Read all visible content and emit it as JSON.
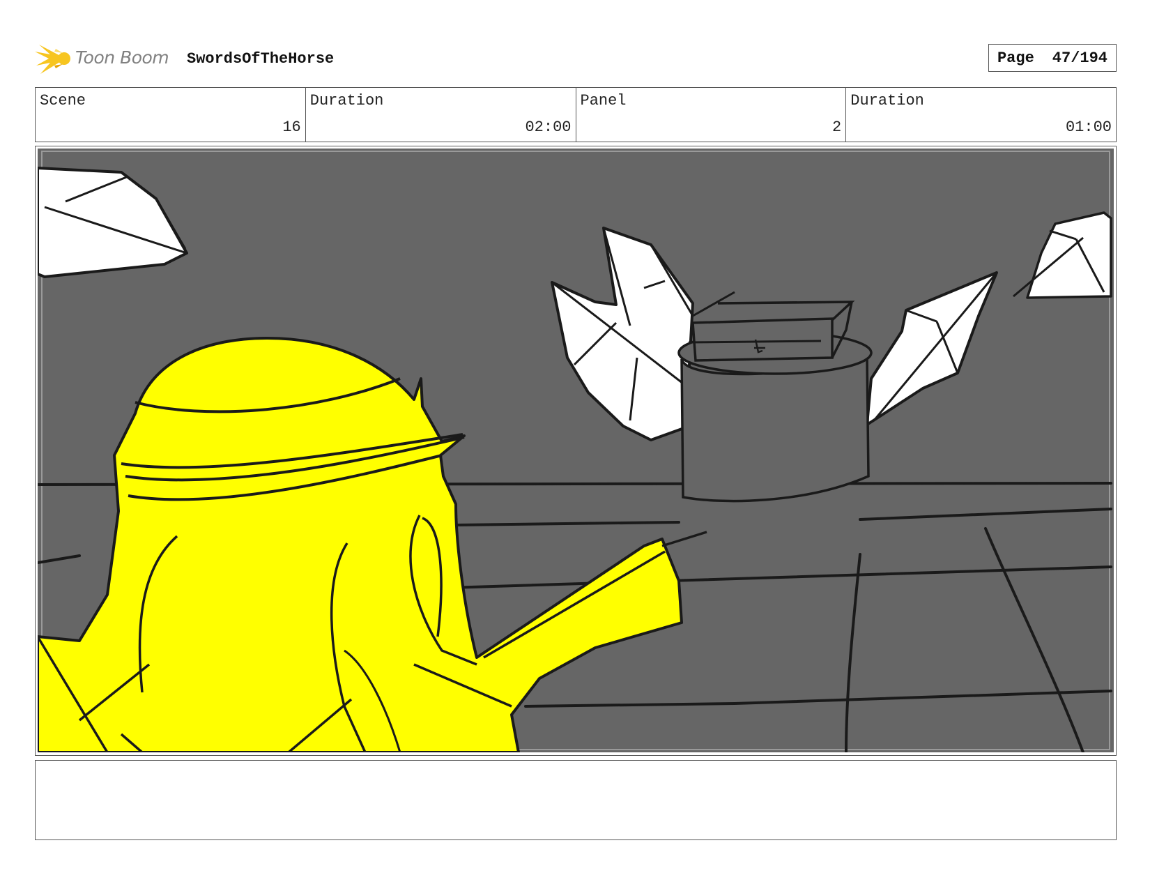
{
  "header": {
    "brand": "Toon Boom",
    "project_title": "SwordsOfTheHorse",
    "page_label": "Page",
    "page_number": "47/194"
  },
  "info": {
    "scene_label": "Scene",
    "scene_value": "16",
    "scene_duration_label": "Duration",
    "scene_duration_value": "02:00",
    "panel_label": "Panel",
    "panel_value": "2",
    "panel_duration_label": "Duration",
    "panel_duration_value": "01:00"
  },
  "colors": {
    "background_gray": "#666666",
    "character_yellow": "#ffff00",
    "logo_yellow": "#f7c51f",
    "crystal_white": "#ffffff",
    "ink": "#1a1a1a"
  },
  "notes": {
    "text": ""
  }
}
